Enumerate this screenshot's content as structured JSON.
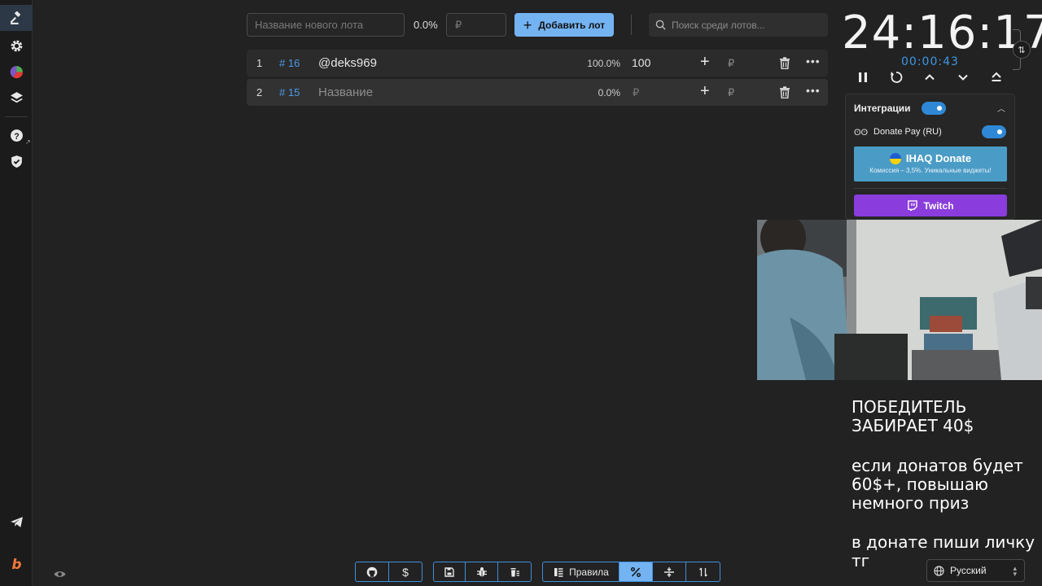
{
  "toolbar": {
    "lot_placeholder": "Название нового лота",
    "percent": "0.0%",
    "amount_placeholder": "₽",
    "add_label": "Добавить лот",
    "search_placeholder": "Поиск среди лотов..."
  },
  "lots": [
    {
      "index": "1",
      "id": "# 16",
      "name": "@deks969",
      "percent": "100.0%",
      "amount": "100",
      "currency": "₽"
    },
    {
      "index": "2",
      "id": "# 15",
      "name": "Название",
      "percent": "0.0%",
      "amount": "₽",
      "currency": "₽"
    }
  ],
  "timer": {
    "main": "24:16:17",
    "elapsed": "00:00:43",
    "swap_icon": "⇅"
  },
  "integrations": {
    "title": "Интеграции",
    "donate_pay_label": "Donate Pay (RU)",
    "ihaq_title": "IHAQ Donate",
    "ihaq_subtitle": "Комиссия – 3,5%. Уникальные виджеты!",
    "twitch_label": "Twitch"
  },
  "overlay": {
    "line1": "ПОБЕДИТЕЛЬ",
    "line2": "ЗАБИРАЕТ 40$",
    "line3": "если донатов будет",
    "line4": "60$+, повышаю",
    "line5": "немного приз",
    "line6": "в донате пиши личку тг"
  },
  "language": {
    "selected": "Русский"
  },
  "bottom_bar": {
    "rules_label": "Правила"
  },
  "colors": {
    "accent": "#74b3f2",
    "link_blue": "#4a9be8",
    "twitch": "#8a3ddc",
    "ihaq": "#4a9cc6",
    "background": "#222222"
  },
  "icons": [
    "gavel-icon",
    "gear-icon",
    "pie-chart-icon",
    "layers-icon",
    "help-icon",
    "shield-check-icon",
    "telegram-icon",
    "brand-b-icon",
    "eye-icon",
    "search-icon",
    "plus-icon",
    "trash-icon",
    "more-icon",
    "pause-icon",
    "restart-icon",
    "chevron-up-icon",
    "chevron-down-icon",
    "eject-icon",
    "github-icon",
    "dollar-icon",
    "save-icon",
    "bug-icon",
    "clear-icon",
    "rules-icon",
    "percent-icon",
    "split-icon",
    "sort-icon",
    "globe-icon",
    "twitch-icon"
  ]
}
